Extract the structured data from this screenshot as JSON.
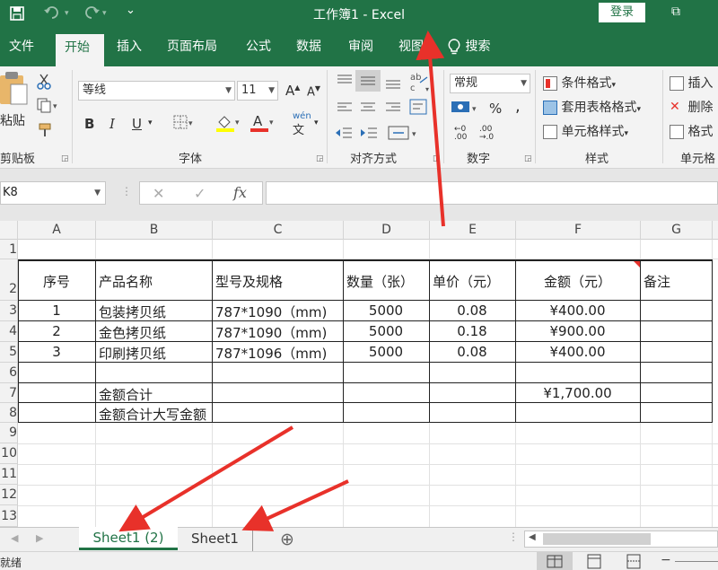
{
  "window": {
    "title": "工作簿1  -  Excel",
    "login_label": "登录",
    "restore_glyph": "⧉"
  },
  "quick_access": {
    "save_icon": "save-icon",
    "undo_icon": "undo-icon",
    "redo_icon": "redo-icon",
    "customize_glyph": "⌄"
  },
  "tabs": [
    {
      "label": "文件"
    },
    {
      "label": "开始"
    },
    {
      "label": "插入"
    },
    {
      "label": "页面布局"
    },
    {
      "label": "公式"
    },
    {
      "label": "数据"
    },
    {
      "label": "审阅"
    },
    {
      "label": "视图"
    }
  ],
  "search_tab": {
    "label": "搜索"
  },
  "ribbon": {
    "clipboard": {
      "paste_label": "粘贴",
      "group_label": "剪贴板"
    },
    "font": {
      "font_name": "等线",
      "font_size": "11",
      "bold": "B",
      "italic": "I",
      "underline": "U",
      "group_label": "字体",
      "grow": "A",
      "shrink": "A",
      "phonetic": "wén"
    },
    "alignment": {
      "group_label": "对齐方式"
    },
    "number": {
      "format": "常规",
      "group_label": "数字",
      "percent": "%",
      "comma": ",",
      "inc_decimal": ".00",
      "dec_decimal": ".00"
    },
    "styles": {
      "conditional": "条件格式",
      "table": "套用表格格式",
      "cell_styles": "单元格样式",
      "group_label": "样式"
    },
    "cells": {
      "insert": "插入",
      "delete": "删除",
      "format": "格式",
      "group_label": "单元格"
    }
  },
  "formula_bar": {
    "name_box": "K8",
    "cancel": "✕",
    "enter": "✓",
    "fx": "fx",
    "value": ""
  },
  "columns": [
    "A",
    "B",
    "C",
    "D",
    "E",
    "F",
    "G"
  ],
  "rows": [
    "1",
    "2",
    "3",
    "4",
    "5",
    "6",
    "7",
    "8",
    "9",
    "10",
    "11",
    "12",
    "13"
  ],
  "table": {
    "headers": [
      "序号",
      "产品名称",
      "型号及规格",
      "数量（张）",
      "单价（元）",
      "金额（元）",
      "备注"
    ],
    "rows": [
      [
        "1",
        "包装拷贝纸",
        "787*1090（mm)",
        "5000",
        "0.08",
        "¥400.00",
        ""
      ],
      [
        "2",
        "金色拷贝纸",
        "787*1090（mm)",
        "5000",
        "0.18",
        "¥900.00",
        ""
      ],
      [
        "3",
        "印刷拷贝纸",
        "787*1096（mm)",
        "5000",
        "0.08",
        "¥400.00",
        ""
      ]
    ],
    "total_label": "金额合计",
    "total_value": "¥1,700.00",
    "total_words_label": "金额合计大写金额"
  },
  "sheets": [
    {
      "label": "Sheet1 (2)",
      "active": true
    },
    {
      "label": "Sheet1",
      "active": false
    }
  ],
  "add_sheet_glyph": "⊕",
  "status": {
    "ready": "就绪"
  },
  "colors": {
    "excel_green": "#217346",
    "arrow_red": "#e8312a"
  }
}
